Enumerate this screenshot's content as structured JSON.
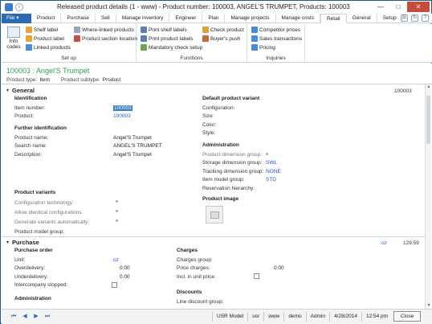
{
  "window": {
    "title": "Released product details (1 - www) - Product number: 100003, ANGEL'S TRUMPET, Products: 100003",
    "minimize": "—",
    "maximize": "□",
    "close": "✕"
  },
  "tabs": {
    "file": "File",
    "items": [
      "Product",
      "Purchase",
      "Sell",
      "Manage inventory",
      "Engineer",
      "Plan",
      "Manage projects",
      "Manage costs",
      "Retail",
      "General",
      "Setup"
    ],
    "active": "Retail"
  },
  "ribbon": {
    "setup": {
      "label": "Set up",
      "info_codes": "Info codes",
      "shelf_label": "Shelf label",
      "product_label": "Product label",
      "linked_products": "Linked products",
      "where_linked": "Where-linked products",
      "product_section_location": "Product section location"
    },
    "functions": {
      "label": "Functions",
      "print_shelf_labels": "Print shelf labels",
      "print_product_labels": "Print product labels",
      "mandatory_check_setup": "Mandatory check setup",
      "check_product": "Check product",
      "buyers_push": "Buyer's push"
    },
    "inquiries": {
      "label": "Inquiries",
      "competitor_prices": "Competitor prices",
      "sales_transactions": "Sales transactions",
      "pricing": "Pricing"
    }
  },
  "header": {
    "title": "100003 : Angel'S Trumpet",
    "product_type_label": "Product type:",
    "product_type": "Item",
    "product_subtype_label": "Product subtype:",
    "product_subtype": "Product"
  },
  "general": {
    "title": "General",
    "summary": "100003",
    "identification": {
      "title": "Identification",
      "item_number_label": "Item number:",
      "item_number": "100003",
      "product_label": "Product:",
      "product": "100003"
    },
    "further_identification": {
      "title": "Further identification",
      "product_name_label": "Product name:",
      "product_name": "Angel'S Trumpet",
      "search_name_label": "Search name:",
      "search_name": "ANGEL'S TRUMPET",
      "description_label": "Description:",
      "description": "Angel'S Trumpet"
    },
    "product_variants": {
      "title": "Product variants",
      "config_tech_label": "Configuration technology:",
      "allow_identical_label": "Allow identical configurations:",
      "generate_variants_label": "Generate variants automatically:",
      "product_model_group_label": "Product model group:"
    },
    "default_variant": {
      "title": "Default product variant",
      "configuration_label": "Configuration:",
      "size_label": "Size:",
      "color_label": "Color:",
      "style_label": "Style:"
    },
    "administration": {
      "title": "Administration",
      "product_dim_group_label": "Product dimension group:",
      "storage_dim_group_label": "Storage dimension group:",
      "storage_dim_group": "SWL",
      "tracking_dim_group_label": "Tracking dimension group:",
      "tracking_dim_group": "NONE",
      "item_model_group_label": "Item model group:",
      "item_model_group": "STD",
      "reservation_hierarchy_label": "Reservation hierarchy:"
    },
    "product_image": {
      "title": "Product image"
    }
  },
  "purchase": {
    "title": "Purchase",
    "summary_unit": "oz",
    "summary_price": "129.59",
    "purchase_order": {
      "title": "Purchase order",
      "unit_label": "Unit:",
      "unit": "oz",
      "overdelivery_label": "Overdelivery:",
      "overdelivery": "0.00",
      "underdelivery_label": "Underdelivery:",
      "underdelivery": "0.00",
      "intercompany_stopped_label": "Intercompany stopped:"
    },
    "administration_title": "Administration",
    "charges": {
      "title": "Charges",
      "charges_group_label": "Charges group:",
      "price_charges_label": "Price charges:",
      "price_charges": "0.00",
      "incl_unit_price_label": "Incl. in unit price:"
    },
    "discounts": {
      "title": "Discounts",
      "line_discount_group_label": "Line discount group:"
    }
  },
  "statusbar": {
    "nav": [
      "⏮",
      "◀",
      "▶",
      "⏭"
    ],
    "cells": [
      "USR Model",
      "usr",
      "www",
      "demo",
      "Admin",
      "4/28/2014",
      "12:54 pm"
    ],
    "close_label": "Close"
  }
}
